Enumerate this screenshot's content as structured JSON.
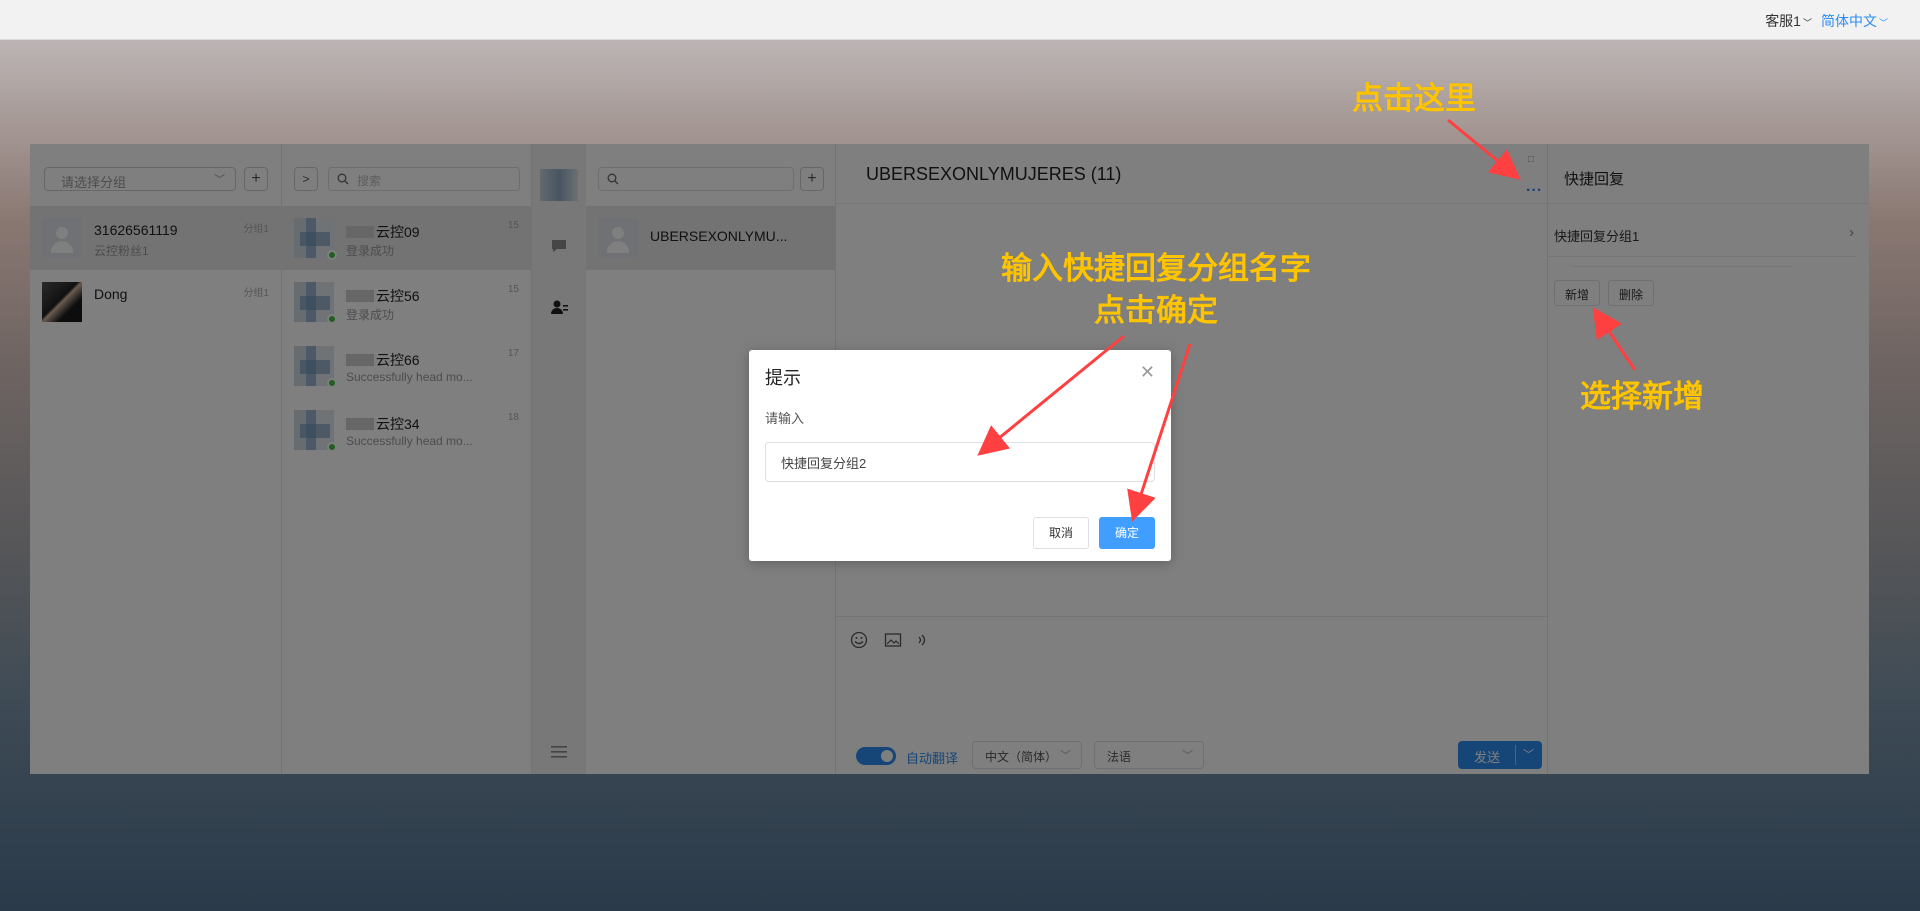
{
  "topbar": {
    "user": "客服1",
    "language": "简体中文"
  },
  "col1": {
    "select_placeholder": "请选择分组",
    "add_label": "+",
    "items": [
      {
        "name": "31626561119",
        "sub": "云控粉丝1",
        "tag": "分组1"
      },
      {
        "name": "Dong",
        "sub": "",
        "tag": "分组1"
      }
    ]
  },
  "col2": {
    "expand_label": ">",
    "search_placeholder": "搜索",
    "items": [
      {
        "name": "云控09",
        "sub": "登录成功",
        "tag": "15"
      },
      {
        "name": "云控56",
        "sub": "登录成功",
        "tag": "15"
      },
      {
        "name": "云控66",
        "sub": "Successfully head mo...",
        "tag": "17"
      },
      {
        "name": "云控34",
        "sub": "Successfully head mo...",
        "tag": "18"
      }
    ]
  },
  "col4": {
    "search_placeholder": "",
    "add_label": "+",
    "items": [
      {
        "name": "UBERSEXONLYMU..."
      }
    ]
  },
  "chat": {
    "title": "UBERSEXONLYMUJERES (11)",
    "more": "...",
    "auto_translate": "自动翻译",
    "source_lang": "中文（简体）",
    "target_lang": "法语",
    "send": "发送"
  },
  "quick_reply": {
    "title": "快捷回复",
    "group": "快捷回复分组1",
    "add_button": "新增",
    "delete_button": "删除"
  },
  "dialog": {
    "title": "提示",
    "label": "请输入",
    "value": "快捷回复分组2",
    "cancel": "取消",
    "confirm": "确定"
  },
  "annotations": {
    "click_here": "点击这里",
    "enter_name_line1": "输入快捷回复分组名字",
    "enter_name_line2": "点击确定",
    "choose_add": "选择新增",
    "color": "#ffc400",
    "arrow_color": "#ff4040"
  }
}
